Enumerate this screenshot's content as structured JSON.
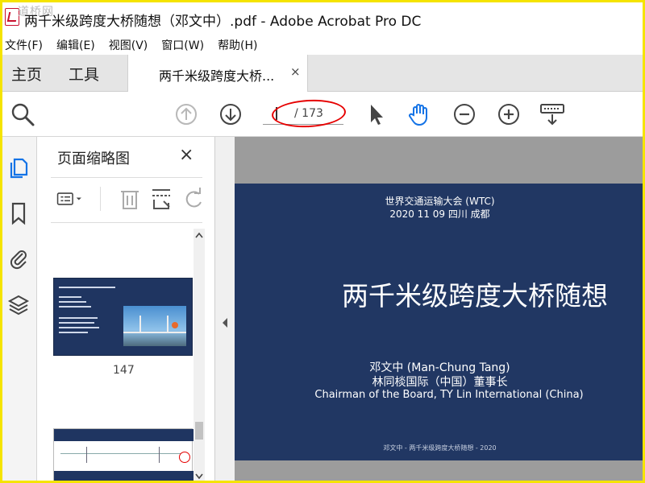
{
  "window": {
    "title": "两千米级跨度大桥随想（邓文中）.pdf - Adobe Acrobat Pro DC",
    "watermark": "道桥网"
  },
  "menu": [
    "文件(F)",
    "编辑(E)",
    "视图(V)",
    "窗口(W)",
    "帮助(H)"
  ],
  "tabs": {
    "home": "主页",
    "tools": "工具",
    "document": "两千米级跨度大桥...",
    "close": "×"
  },
  "toolbar": {
    "page_total": "/ 173",
    "icons": [
      "search-icon",
      "previous-page-icon",
      "next-page-icon",
      "select-arrow-icon",
      "hand-tool-icon",
      "zoom-out-icon",
      "zoom-in-icon",
      "keyboard-scroll-icon"
    ]
  },
  "sidebar": {
    "icons": [
      "pages-icon",
      "bookmark-icon",
      "attachment-icon",
      "layers-icon"
    ]
  },
  "panel": {
    "title": "页面缩略图",
    "close": "×",
    "thumbnails": [
      {
        "label": "147"
      }
    ]
  },
  "slide": {
    "conference": "世界交通运输大会 (WTC)",
    "date_place": "2020 11 09  四川 成都",
    "title": "两千米级跨度大桥随想",
    "author": "邓文中  (Man-Chung Tang)",
    "org": "林同棪国际（中国）董事长",
    "role": "Chairman of the Board, TY Lin International (China)",
    "footer": "邓文中 - 两千米级跨度大桥随想 - 2020"
  },
  "colors": {
    "slide_bg": "#213763",
    "highlight_ellipse": "#e60000",
    "frame": "#f5e400",
    "icon_blue": "#1473e6"
  }
}
